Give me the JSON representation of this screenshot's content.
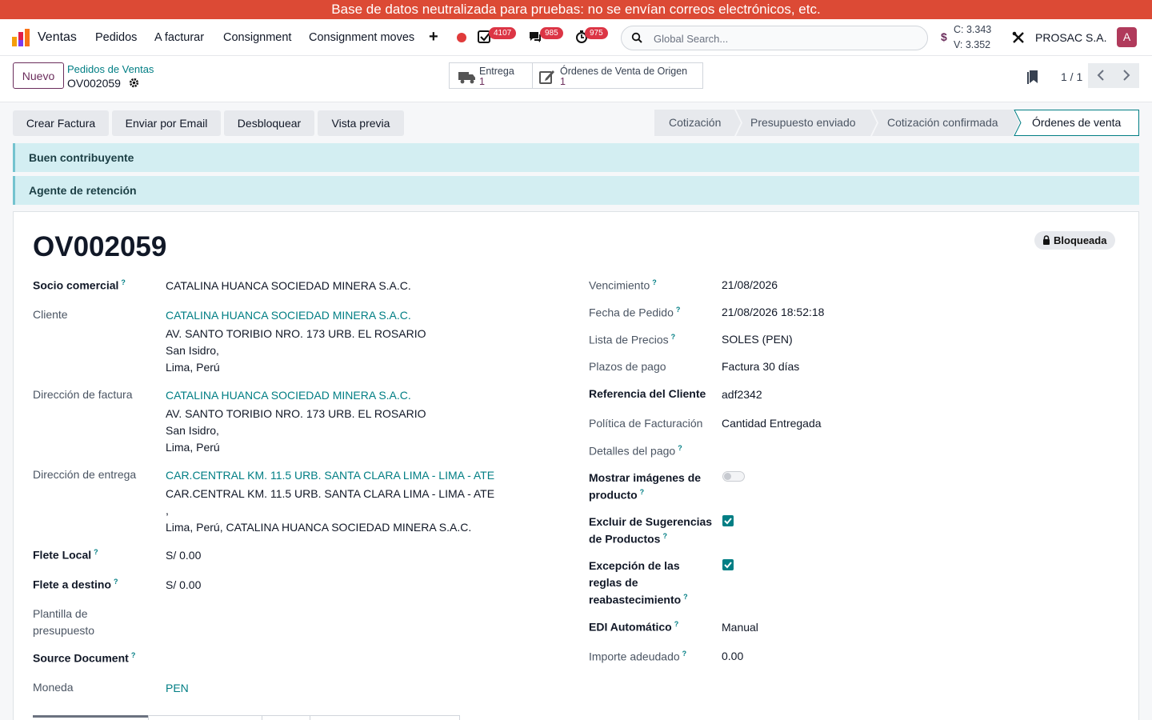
{
  "banner": "Base de datos neutralizada para pruebas: no se envían correos electrónicos, etc.",
  "navbar": {
    "app_name": "Ventas",
    "menu": [
      "Pedidos",
      "A facturar",
      "Consignment",
      "Consignment moves"
    ],
    "badges": {
      "activities": "4107",
      "messages": "985",
      "timers": "975"
    },
    "search_placeholder": "Global Search...",
    "currency": {
      "symbol": "$",
      "buy": "C: 3.343",
      "sell": "V: 3.352"
    },
    "company": "PROSAC S.A.",
    "avatar_letter": "A",
    "colors": {
      "brand": "#6b2d5c",
      "accent": "#017e84",
      "banner": "#dc4a35",
      "badge": "#dc3545"
    }
  },
  "control": {
    "new_label": "Nuevo",
    "breadcrumb_parent": "Pedidos de Ventas",
    "breadcrumb_current": "OV002059",
    "smart_buttons": [
      {
        "label": "Entrega",
        "count": "1",
        "icon": "truck-icon"
      },
      {
        "label": "Órdenes de Venta de Origen",
        "count": "1",
        "icon": "edit-icon"
      }
    ],
    "pager": "1 / 1"
  },
  "actions": [
    "Crear Factura",
    "Enviar por Email",
    "Desbloquear",
    "Vista previa"
  ],
  "statusbar": [
    "Cotización",
    "Presupuesto enviado",
    "Cotización confirmada",
    "Órdenes de venta"
  ],
  "alerts": [
    "Buen contribuyente",
    "Agente de retención"
  ],
  "form": {
    "title": "OV002059",
    "locked": "Bloqueada",
    "left": {
      "socio_label": "Socio comercial",
      "socio_value": "CATALINA HUANCA SOCIEDAD MINERA S.A.C.",
      "cliente_label": "Cliente",
      "cliente_name": "CATALINA HUANCA SOCIEDAD MINERA S.A.C.",
      "cliente_addr1": "AV. SANTO TORIBIO NRO. 173 URB. EL ROSARIO",
      "cliente_addr2": "San Isidro,",
      "cliente_addr3": "Lima, Perú",
      "factura_label": "Dirección de factura",
      "factura_name": "CATALINA HUANCA SOCIEDAD MINERA S.A.C.",
      "factura_addr1": "AV. SANTO TORIBIO NRO. 173 URB. EL ROSARIO",
      "factura_addr2": "San Isidro,",
      "factura_addr3": "Lima, Perú",
      "entrega_label": "Dirección de entrega",
      "entrega_name": "CAR.CENTRAL KM. 11.5 URB. SANTA CLARA LIMA - LIMA - ATE",
      "entrega_addr1": "CAR.CENTRAL KM. 11.5 URB. SANTA CLARA LIMA - LIMA - ATE",
      "entrega_addr2": ",",
      "entrega_addr3": "Lima, Perú, CATALINA HUANCA SOCIEDAD MINERA S.A.C.",
      "flete_local_label": "Flete Local",
      "flete_local_value": "S/ 0.00",
      "flete_destino_label": "Flete a destino",
      "flete_destino_value": "S/ 0.00",
      "plantilla_label_1": "Plantilla de",
      "plantilla_label_2": "presupuesto",
      "source_label": "Source Document",
      "moneda_label": "Moneda",
      "moneda_value": "PEN"
    },
    "right": {
      "vencimiento_label": "Vencimiento",
      "vencimiento_value": "21/08/2026",
      "fecha_label": "Fecha de Pedido",
      "fecha_value": "21/08/2026 18:52:18",
      "lista_label": "Lista de Precios",
      "lista_value": "SOLES (PEN)",
      "plazos_label": "Plazos de pago",
      "plazos_value": "Factura 30 días",
      "referencia_label": "Referencia del Cliente",
      "referencia_value": "adf2342",
      "politica_label": "Política de Facturación",
      "politica_value": "Cantidad Entregada",
      "detalles_label": "Detalles del pago",
      "mostrar_label_1": "Mostrar imágenes de",
      "mostrar_label_2": "producto",
      "mostrar_value": false,
      "excluir_label_1": "Excluir de Sugerencias",
      "excluir_label_2": "de Productos",
      "excluir_value": true,
      "excepcion_label_1": "Excepción de las",
      "excepcion_label_2": "reglas de",
      "excepcion_label_3": "reabastecimiento",
      "excepcion_value": true,
      "edi_label": "EDI Automático",
      "edi_value": "Manual",
      "importe_label": "Importe adeudado",
      "importe_value": "0.00"
    },
    "help_mark": "?"
  }
}
